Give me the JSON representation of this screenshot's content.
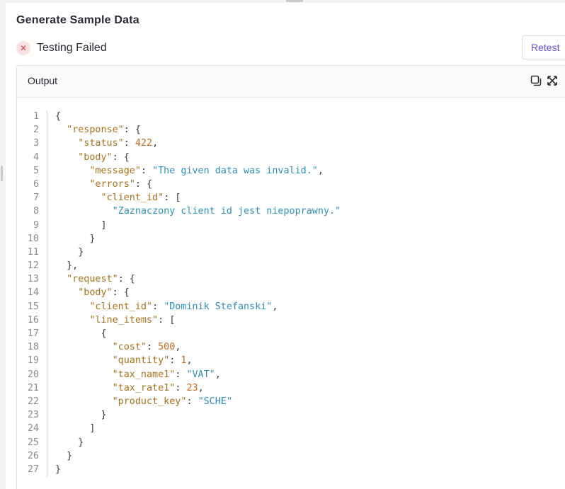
{
  "section_title": "Generate Sample Data",
  "status": {
    "text": "Testing Failed",
    "icon": "x-circle-icon",
    "color": "#d23b3b"
  },
  "retest_label": "Retest",
  "output": {
    "title": "Output",
    "icons": [
      "copy-icon",
      "expand-icon"
    ]
  },
  "code_lines": [
    [
      {
        "t": "p",
        "v": "{"
      }
    ],
    [
      {
        "t": "p",
        "v": "  "
      },
      {
        "t": "k",
        "v": "\"response\""
      },
      {
        "t": "p",
        "v": ": {"
      }
    ],
    [
      {
        "t": "p",
        "v": "    "
      },
      {
        "t": "k",
        "v": "\"status\""
      },
      {
        "t": "p",
        "v": ": "
      },
      {
        "t": "n",
        "v": "422"
      },
      {
        "t": "p",
        "v": ","
      }
    ],
    [
      {
        "t": "p",
        "v": "    "
      },
      {
        "t": "k",
        "v": "\"body\""
      },
      {
        "t": "p",
        "v": ": {"
      }
    ],
    [
      {
        "t": "p",
        "v": "      "
      },
      {
        "t": "k",
        "v": "\"message\""
      },
      {
        "t": "p",
        "v": ": "
      },
      {
        "t": "s",
        "v": "\"The given data was invalid.\""
      },
      {
        "t": "p",
        "v": ","
      }
    ],
    [
      {
        "t": "p",
        "v": "      "
      },
      {
        "t": "k",
        "v": "\"errors\""
      },
      {
        "t": "p",
        "v": ": {"
      }
    ],
    [
      {
        "t": "p",
        "v": "        "
      },
      {
        "t": "k",
        "v": "\"client_id\""
      },
      {
        "t": "p",
        "v": ": ["
      }
    ],
    [
      {
        "t": "p",
        "v": "          "
      },
      {
        "t": "s",
        "v": "\"Zaznaczony client id jest niepoprawny.\""
      }
    ],
    [
      {
        "t": "p",
        "v": "        ]"
      }
    ],
    [
      {
        "t": "p",
        "v": "      }"
      }
    ],
    [
      {
        "t": "p",
        "v": "    }"
      }
    ],
    [
      {
        "t": "p",
        "v": "  },"
      }
    ],
    [
      {
        "t": "p",
        "v": "  "
      },
      {
        "t": "k",
        "v": "\"request\""
      },
      {
        "t": "p",
        "v": ": {"
      }
    ],
    [
      {
        "t": "p",
        "v": "    "
      },
      {
        "t": "k",
        "v": "\"body\""
      },
      {
        "t": "p",
        "v": ": {"
      }
    ],
    [
      {
        "t": "p",
        "v": "      "
      },
      {
        "t": "k",
        "v": "\"client_id\""
      },
      {
        "t": "p",
        "v": ": "
      },
      {
        "t": "s",
        "v": "\"Dominik Stefanski\""
      },
      {
        "t": "p",
        "v": ","
      }
    ],
    [
      {
        "t": "p",
        "v": "      "
      },
      {
        "t": "k",
        "v": "\"line_items\""
      },
      {
        "t": "p",
        "v": ": ["
      }
    ],
    [
      {
        "t": "p",
        "v": "        {"
      }
    ],
    [
      {
        "t": "p",
        "v": "          "
      },
      {
        "t": "k",
        "v": "\"cost\""
      },
      {
        "t": "p",
        "v": ": "
      },
      {
        "t": "n",
        "v": "500"
      },
      {
        "t": "p",
        "v": ","
      }
    ],
    [
      {
        "t": "p",
        "v": "          "
      },
      {
        "t": "k",
        "v": "\"quantity\""
      },
      {
        "t": "p",
        "v": ": "
      },
      {
        "t": "n",
        "v": "1"
      },
      {
        "t": "p",
        "v": ","
      }
    ],
    [
      {
        "t": "p",
        "v": "          "
      },
      {
        "t": "k",
        "v": "\"tax_name1\""
      },
      {
        "t": "p",
        "v": ": "
      },
      {
        "t": "s",
        "v": "\"VAT\""
      },
      {
        "t": "p",
        "v": ","
      }
    ],
    [
      {
        "t": "p",
        "v": "          "
      },
      {
        "t": "k",
        "v": "\"tax_rate1\""
      },
      {
        "t": "p",
        "v": ": "
      },
      {
        "t": "n",
        "v": "23"
      },
      {
        "t": "p",
        "v": ","
      }
    ],
    [
      {
        "t": "p",
        "v": "          "
      },
      {
        "t": "k",
        "v": "\"product_key\""
      },
      {
        "t": "p",
        "v": ": "
      },
      {
        "t": "s",
        "v": "\"SCHE\""
      }
    ],
    [
      {
        "t": "p",
        "v": "        }"
      }
    ],
    [
      {
        "t": "p",
        "v": "      ]"
      }
    ],
    [
      {
        "t": "p",
        "v": "    }"
      }
    ],
    [
      {
        "t": "p",
        "v": "  }"
      }
    ],
    [
      {
        "t": "p",
        "v": "}"
      }
    ]
  ],
  "colors": {
    "key": "#a8721c",
    "string": "#2e8fb8",
    "number": "#c46a1f",
    "accent": "#6a4fd8"
  }
}
